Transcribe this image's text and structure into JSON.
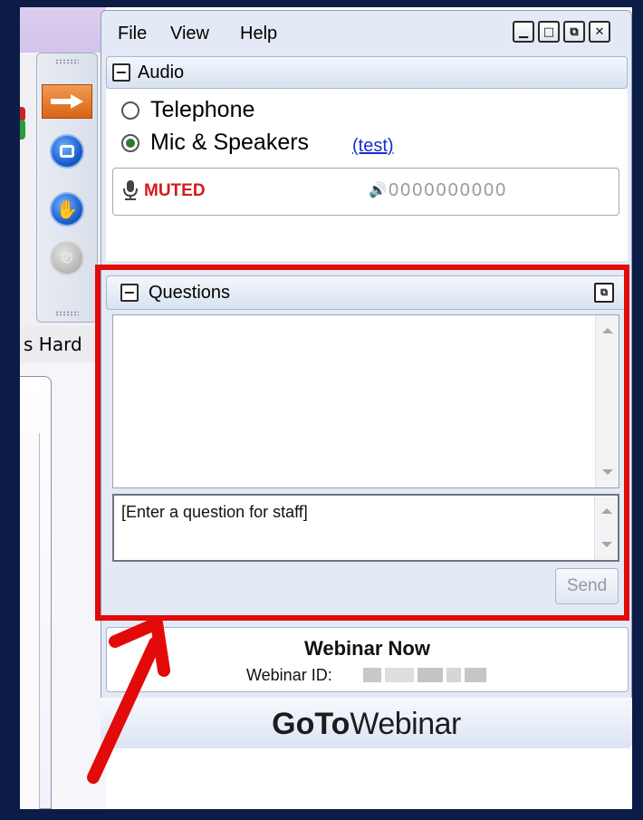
{
  "menu": {
    "items": [
      "File",
      "View",
      "Help"
    ]
  },
  "window_controls": {
    "minimize_icon": "minimize-icon",
    "maximize_icon": "restore-icon",
    "popout_icon": "popout-icon",
    "close_icon": "close-icon"
  },
  "background_app": {
    "partial_text": "s Hard"
  },
  "audio": {
    "title": "Audio",
    "collapse_symbol": "−",
    "option_telephone": "Telephone",
    "option_mic": "Mic & Speakers",
    "test_link": "(test)",
    "selected": "Mic & Speakers",
    "mic_status": "MUTED",
    "level_meter": "0000000000"
  },
  "questions": {
    "title": "Questions",
    "collapse_symbol": "−",
    "input_text": "[Enter a question for staff]",
    "send_label": "Send"
  },
  "webinar": {
    "title": "Webinar Now",
    "id_label": "Webinar ID:"
  },
  "brand": {
    "bold_part": "GoTo",
    "light_part": "Webinar"
  },
  "colors": {
    "frame": "#0b1d47",
    "highlight": "#e30a0a",
    "muted": "#d31c1c",
    "link": "#1a2ec8"
  }
}
